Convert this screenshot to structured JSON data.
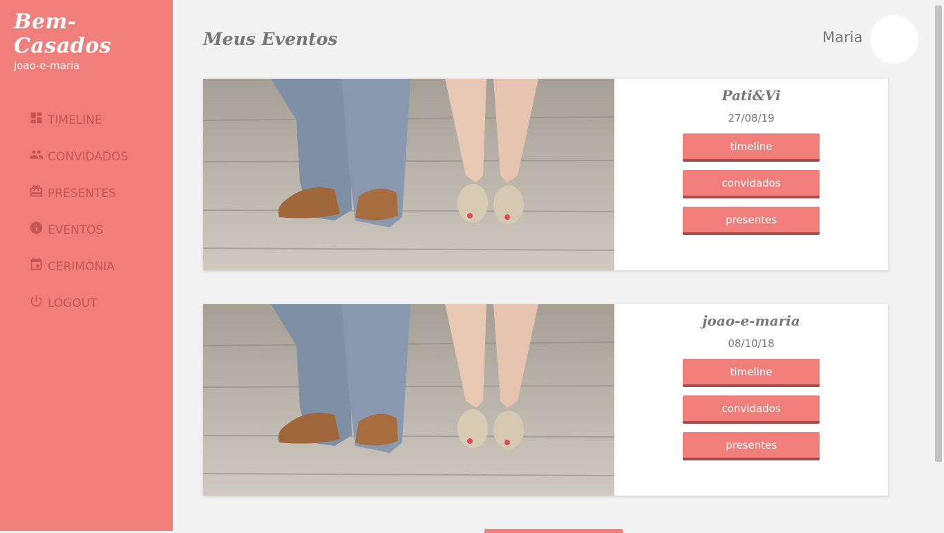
{
  "app": {
    "brand": "Bem-Casados",
    "user_slug": "joao-e-maria"
  },
  "nav": [
    {
      "label": "TIMELINE",
      "icon": "dashboard-icon"
    },
    {
      "label": "CONVIDADOS",
      "icon": "people-icon"
    },
    {
      "label": "PRESENTES",
      "icon": "gift-card-icon"
    },
    {
      "label": "EVENTOS",
      "icon": "info-icon"
    },
    {
      "label": "CERIMÔNIA",
      "icon": "calendar-event-icon"
    },
    {
      "label": "LOGOUT",
      "icon": "power-icon"
    }
  ],
  "header": {
    "title": "Meus Eventos",
    "user_name": "Maria"
  },
  "events": [
    {
      "name": "Pati&Vi",
      "date": "27/08/19",
      "buttons": [
        "timeline",
        "convidados",
        "presentes"
      ]
    },
    {
      "name": "joao-e-maria",
      "date": "08/10/18",
      "buttons": [
        "timeline",
        "convidados",
        "presentes"
      ]
    }
  ],
  "colors": {
    "accent": "#f07f7b",
    "accent_dark": "#c65652",
    "background": "#f2f2f2"
  }
}
